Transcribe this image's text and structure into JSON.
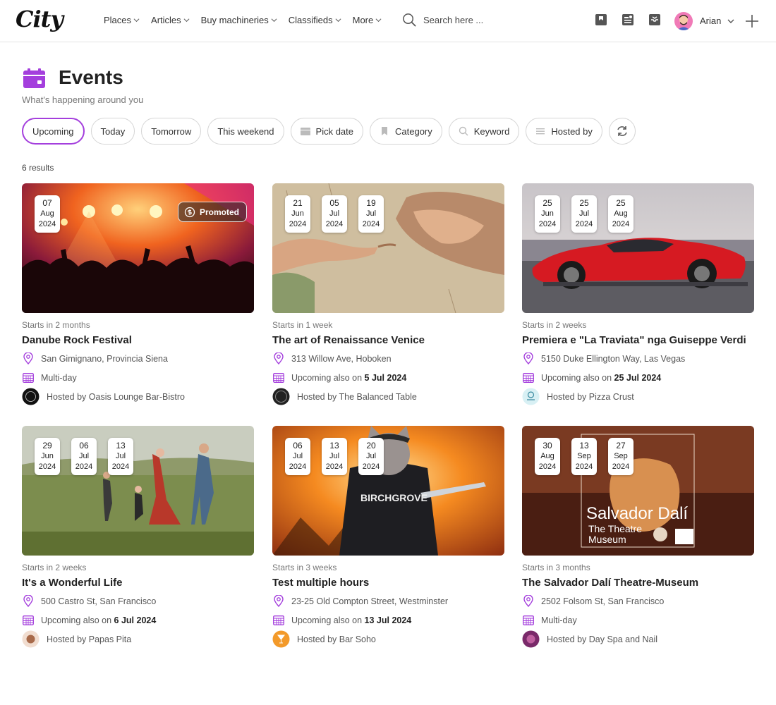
{
  "app": {
    "logo": "City"
  },
  "nav": [
    {
      "label": "Places"
    },
    {
      "label": "Articles"
    },
    {
      "label": "Buy machineries"
    },
    {
      "label": "Classifieds"
    },
    {
      "label": "More"
    }
  ],
  "search": {
    "placeholder": "Search here ..."
  },
  "user": {
    "name": "Arian"
  },
  "page": {
    "title": "Events",
    "subtitle": "What's happening around you",
    "results": "6 results"
  },
  "filters": {
    "upcoming": "Upcoming",
    "today": "Today",
    "tomorrow": "Tomorrow",
    "weekend": "This weekend",
    "pick_date": "Pick date",
    "category": "Category",
    "keyword": "Keyword",
    "hosted_by": "Hosted by"
  },
  "colors": {
    "accent": "#a43fdd",
    "text": "#222222",
    "muted": "#777777"
  },
  "events": [
    {
      "dates": [
        {
          "day": "07",
          "month": "Aug",
          "year": "2024"
        }
      ],
      "badge": "Promoted",
      "starts": "Starts in 2 months",
      "title": "Danube Rock Festival",
      "location": "San Gimignano, Provincia Siena",
      "schedule": "Multi-day",
      "schedule_date": "",
      "host_prefix": "Hosted by ",
      "host": "Oasis Lounge Bar-Bistro"
    },
    {
      "dates": [
        {
          "day": "21",
          "month": "Jun",
          "year": "2024"
        },
        {
          "day": "05",
          "month": "Jul",
          "year": "2024"
        },
        {
          "day": "19",
          "month": "Jul",
          "year": "2024"
        }
      ],
      "starts": "Starts in 1 week",
      "title": "The art of Renaissance Venice",
      "location": "313 Willow Ave, Hoboken",
      "schedule": "Upcoming also on ",
      "schedule_date": "5 Jul 2024",
      "host_prefix": "Hosted by ",
      "host": "The Balanced Table"
    },
    {
      "dates": [
        {
          "day": "25",
          "month": "Jun",
          "year": "2024"
        },
        {
          "day": "25",
          "month": "Jul",
          "year": "2024"
        },
        {
          "day": "25",
          "month": "Aug",
          "year": "2024"
        }
      ],
      "starts": "Starts in 2 weeks",
      "title": "Premiera e \"La Traviata\" nga Guiseppe Verdi",
      "location": "5150 Duke Ellington Way, Las Vegas",
      "schedule": "Upcoming also on ",
      "schedule_date": "25 Jul 2024",
      "host_prefix": "Hosted by ",
      "host": "Pizza Crust"
    },
    {
      "dates": [
        {
          "day": "29",
          "month": "Jun",
          "year": "2024"
        },
        {
          "day": "06",
          "month": "Jul",
          "year": "2024"
        },
        {
          "day": "13",
          "month": "Jul",
          "year": "2024"
        }
      ],
      "starts": "Starts in 2 weeks",
      "title": "It's a Wonderful Life",
      "location": "500 Castro St, San Francisco",
      "schedule": "Upcoming also on ",
      "schedule_date": "6 Jul 2024",
      "host_prefix": "Hosted by ",
      "host": "Papas Pita"
    },
    {
      "dates": [
        {
          "day": "06",
          "month": "Jul",
          "year": "2024"
        },
        {
          "day": "13",
          "month": "Jul",
          "year": "2024"
        },
        {
          "day": "20",
          "month": "Jul",
          "year": "2024"
        }
      ],
      "starts": "Starts in 3 weeks",
      "title": "Test multiple hours",
      "location": "23-25 Old Compton Street, Westminster",
      "schedule": "Upcoming also on ",
      "schedule_date": "13 Jul 2024",
      "host_prefix": "Hosted by ",
      "host": "Bar Soho",
      "image_text": "BIRCHGROVE"
    },
    {
      "dates": [
        {
          "day": "30",
          "month": "Aug",
          "year": "2024"
        },
        {
          "day": "13",
          "month": "Sep",
          "year": "2024"
        },
        {
          "day": "27",
          "month": "Sep",
          "year": "2024"
        }
      ],
      "starts": "Starts in 3 months",
      "title": "The Salvador Dalí Theatre-Museum",
      "location": "2502 Folsom St, San Francisco",
      "schedule": "Multi-day",
      "schedule_date": "",
      "host_prefix": "Hosted by ",
      "host": "Day Spa and Nail",
      "image_text": "Salvador Dalí",
      "image_subtext_1": "The Theatre",
      "image_subtext_2": "Museum"
    }
  ]
}
